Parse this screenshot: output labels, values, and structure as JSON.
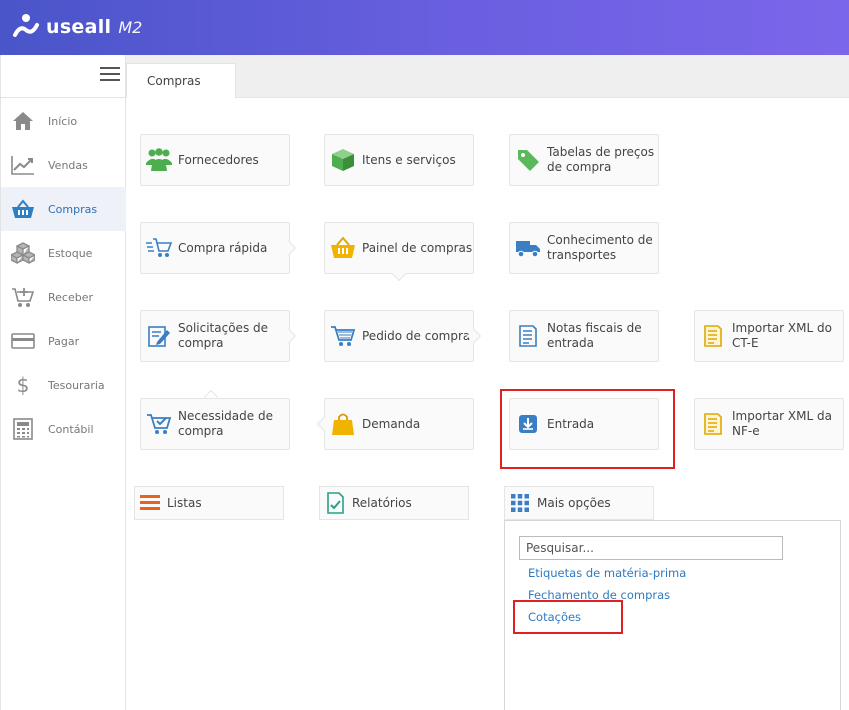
{
  "app": {
    "logo_text": "useall",
    "logo_suffix": "M2",
    "accent": "#5b5fd6"
  },
  "sidebar": {
    "items": [
      {
        "label": "Início",
        "icon": "home-icon"
      },
      {
        "label": "Vendas",
        "icon": "chart-icon"
      },
      {
        "label": "Compras",
        "icon": "basket-icon",
        "active": true
      },
      {
        "label": "Estoque",
        "icon": "boxes-icon"
      },
      {
        "label": "Receber",
        "icon": "cart-plus-icon"
      },
      {
        "label": "Pagar",
        "icon": "credit-card-icon"
      },
      {
        "label": "Tesouraria",
        "icon": "dollar-icon"
      },
      {
        "label": "Contábil",
        "icon": "calculator-icon"
      }
    ]
  },
  "tabs": [
    {
      "label": "Compras"
    }
  ],
  "cards": {
    "fornecedores": "Fornecedores",
    "itens": "Itens e serviços",
    "tabelas": "Tabelas de preços de compra",
    "compra_rapida": "Compra rápida",
    "painel": "Painel de compras",
    "conhecimento": "Conhecimento de transportes",
    "solicitacoes": "Solicitações de compra",
    "pedido": "Pedido de compra",
    "notas": "Notas fiscais de entrada",
    "xml_cte": "Importar XML do CT-E",
    "necessidade": "Necessidade de compra",
    "demanda": "Demanda",
    "entrada": "Entrada",
    "xml_nfe": "Importar XML da NF-e"
  },
  "bottom": {
    "listas": "Listas",
    "relatorios": "Relatórios",
    "mais_opcoes": "Mais opções"
  },
  "dropdown": {
    "search_placeholder": "Pesquisar...",
    "links": [
      "Etiquetas de matéria-prima",
      "Fechamento de compras",
      "Cotações"
    ]
  }
}
